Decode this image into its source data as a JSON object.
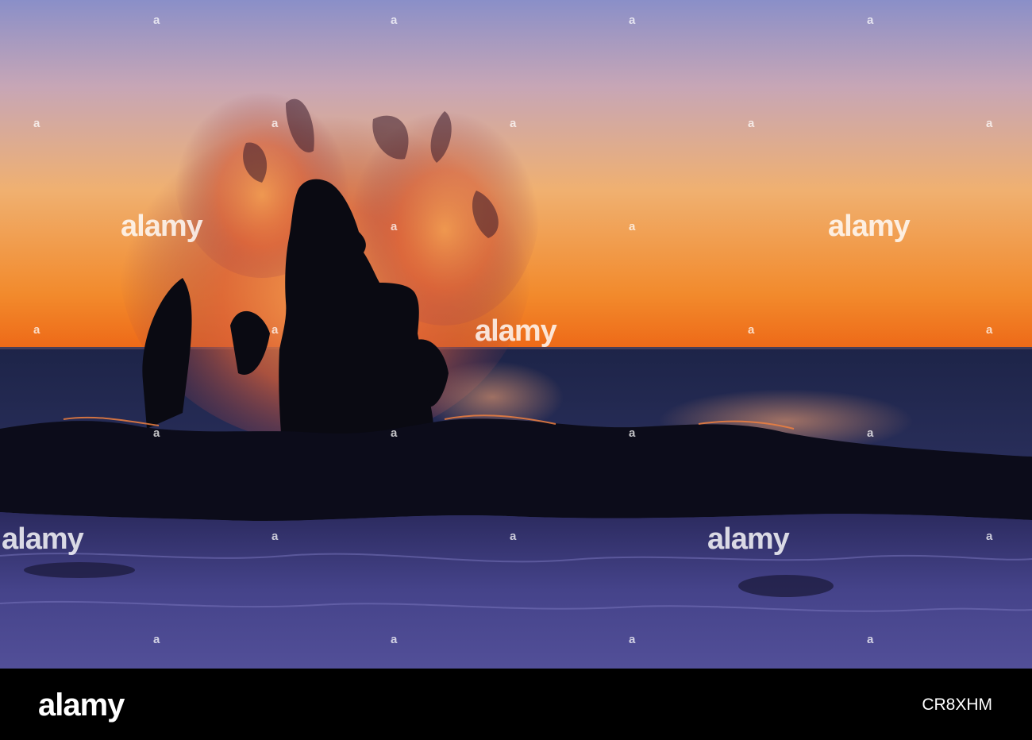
{
  "photo": {
    "subject": "sea-stack-wave-splash-sunset",
    "colors": {
      "sky_top": "#8a8fc8",
      "sky_mid": "#f0a868",
      "sky_horizon": "#f07a20",
      "sea": "#232a52",
      "sea_foreground": "#4e4a90",
      "silhouette": "#0a0a12",
      "spray": "#e8703a"
    }
  },
  "watermark": {
    "brand": "alamy",
    "small_mark": "a"
  },
  "footer": {
    "logo": "alamy",
    "image_id": "CR8XHM"
  }
}
